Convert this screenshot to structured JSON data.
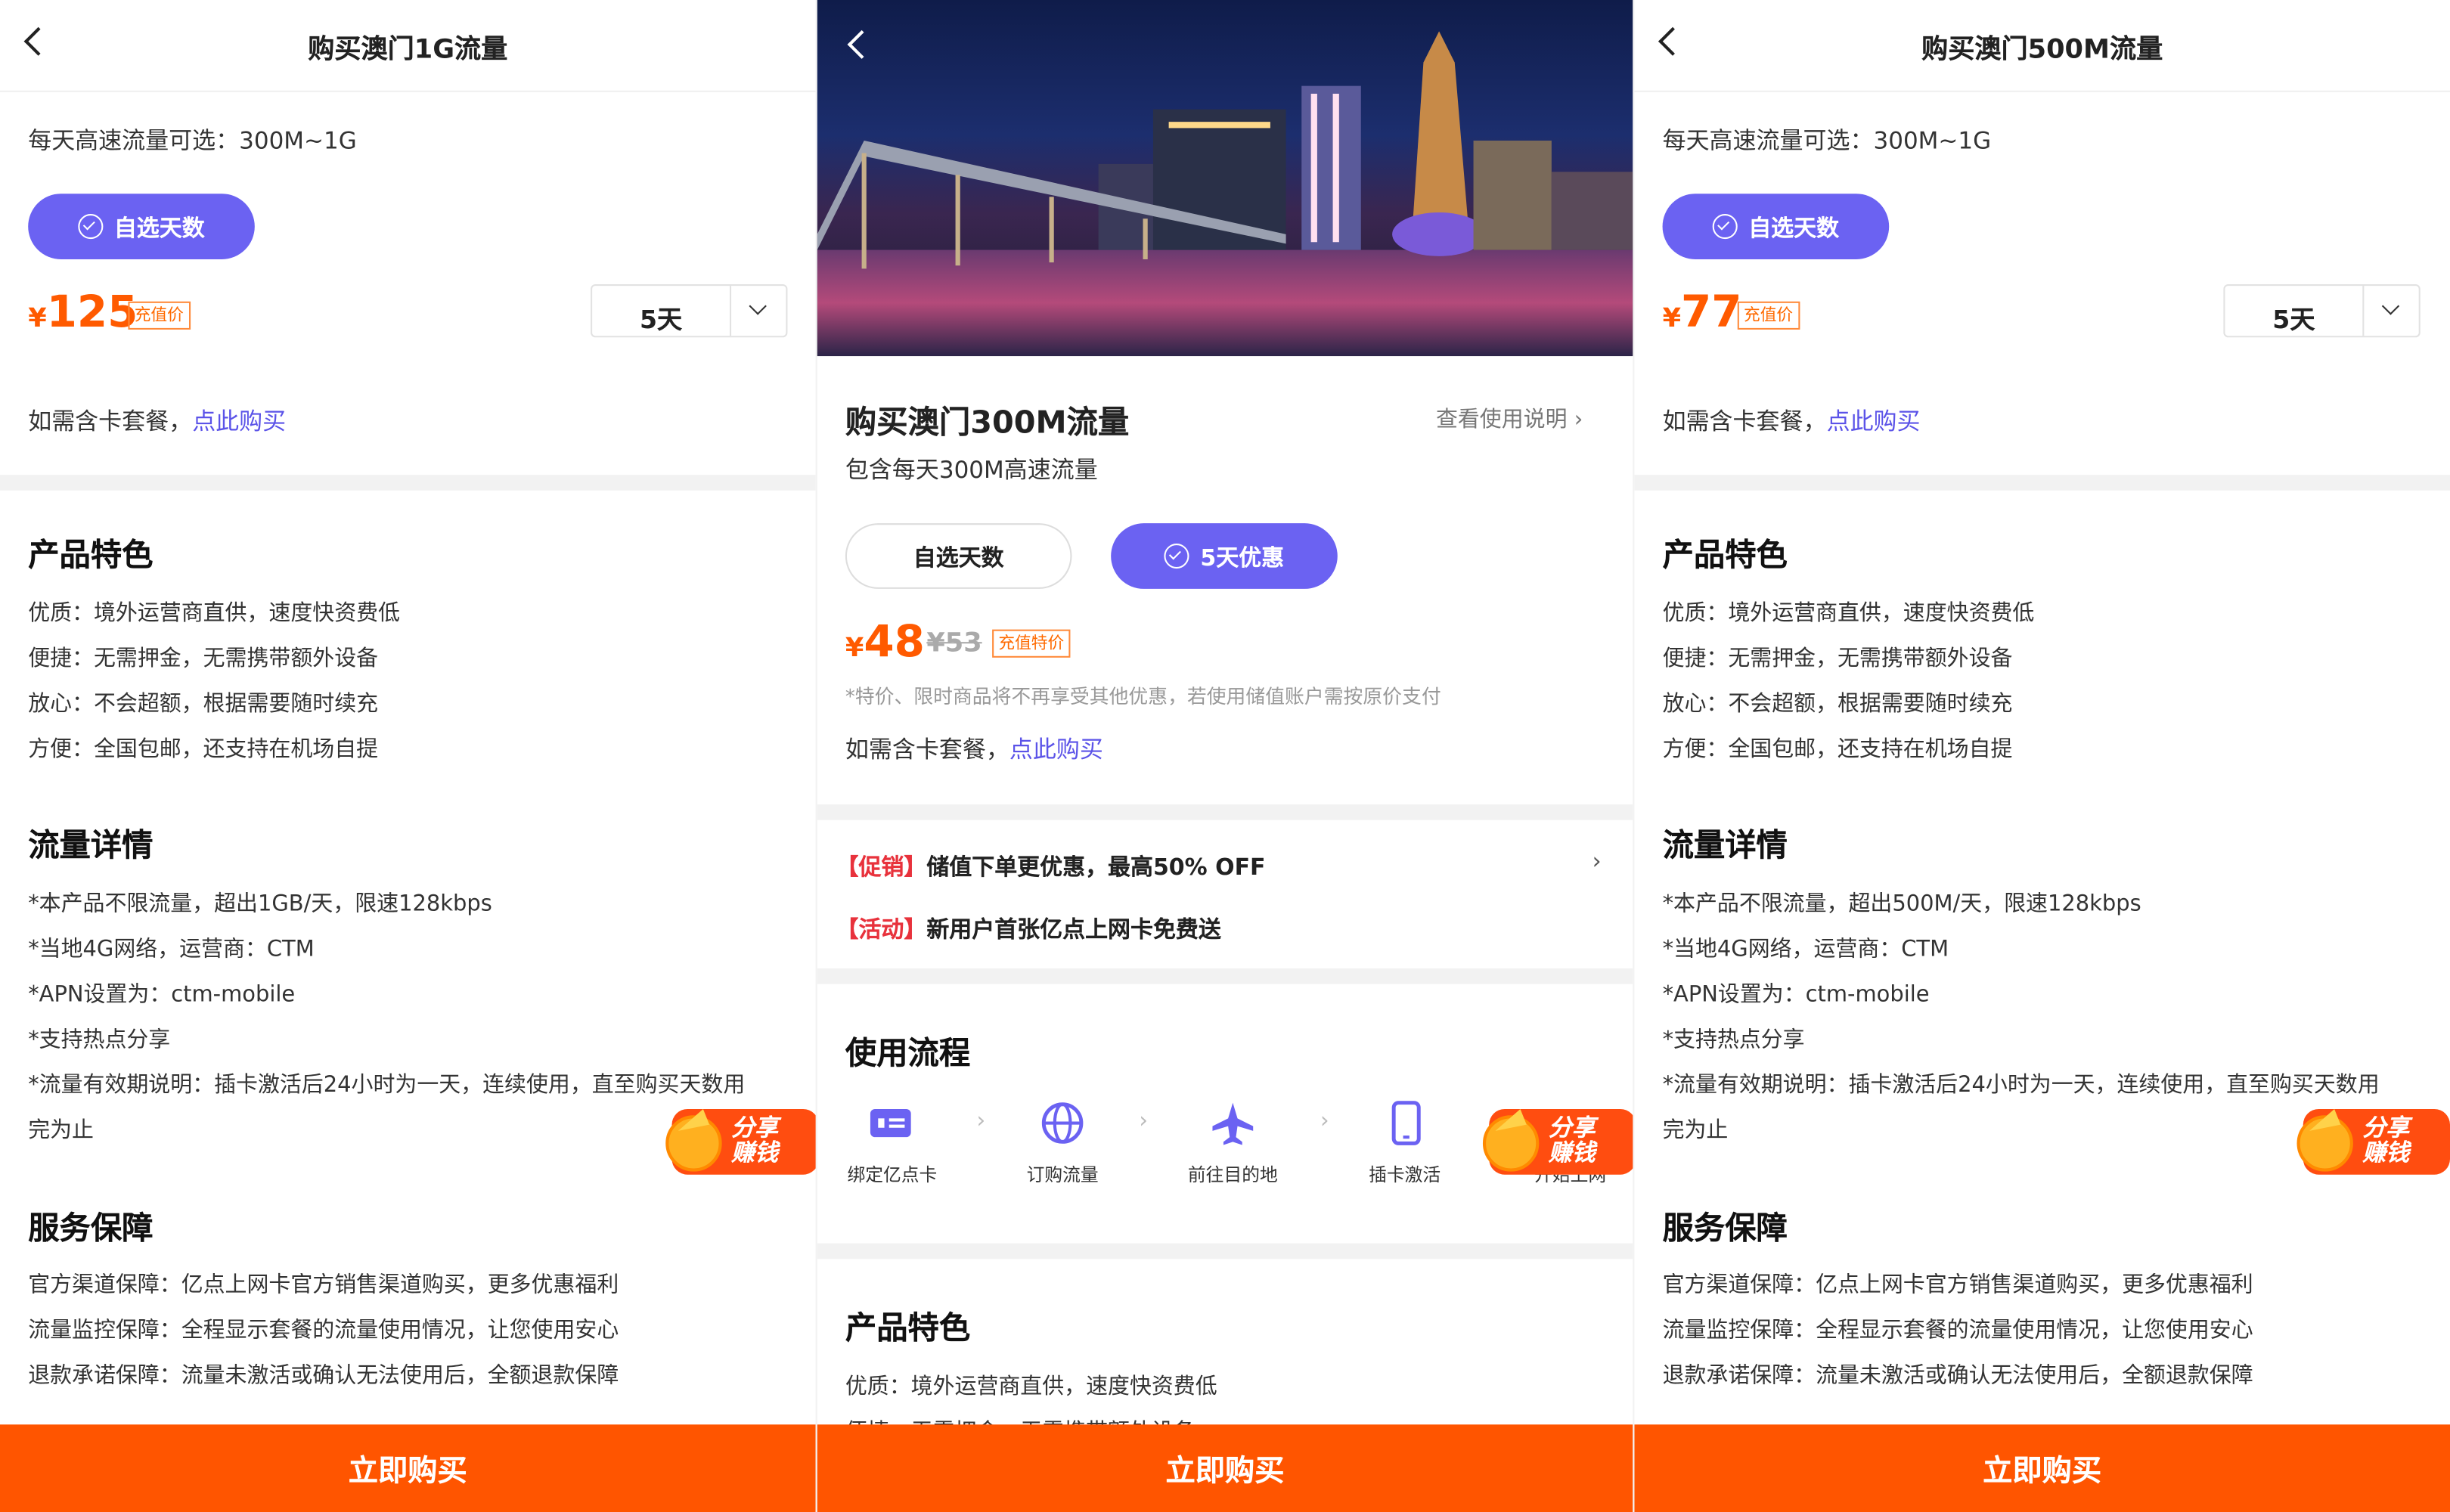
{
  "panel1": {
    "title": "购买澳门1G流量",
    "daily_option": "每天高速流量可选：300M~1G",
    "pill_label": "自选天数",
    "price_symbol": "¥",
    "price": "125",
    "price_tag": "充值价",
    "days_value": "5天",
    "card_prefix": "如需含卡套餐，",
    "card_link": "点此购买",
    "features_title": "产品特色",
    "features": [
      "优质：境外运营商直供，速度快资费低",
      "便捷：无需押金，无需携带额外设备",
      "放心：不会超额，根据需要随时续充",
      "方便：全国包邮，还支持在机场自提"
    ],
    "details_title": "流量详情",
    "details": [
      "*本产品不限流量，超出1GB/天，限速128kbps",
      "*当地4G网络，运营商：CTM",
      "*APN设置为：ctm-mobile",
      "*支持热点分享",
      "*流量有效期说明：插卡激活后24小时为一天，连续使用，直至购买天数用",
      "完为止"
    ],
    "service_title": "服务保障",
    "service": [
      "官方渠道保障：亿点上网卡官方销售渠道购买，更多优惠福利",
      "流量监控保障：全程显示套餐的流量使用情况，让您使用安心",
      "退款承诺保障：流量未激活或确认无法使用后，全额退款保障"
    ],
    "badge_line1": "分享",
    "badge_line2": "赚钱",
    "buy_label": "立即购买"
  },
  "panel2": {
    "title": "购买澳门300M流量",
    "instructions_link": "查看使用说明",
    "subtitle": "包含每天300M高速流量",
    "pill_custom": "自选天数",
    "pill_selected": "5天优惠",
    "price_symbol": "¥",
    "price": "48",
    "old_price": "¥53",
    "price_tag": "充值特价",
    "note": "*特价、限时商品将不再享受其他优惠，若使用储值账户需按原价支付",
    "card_prefix": "如需含卡套餐，",
    "card_link": "点此购买",
    "promo1_key": "【促销】",
    "promo1_text": "储值下单更优惠，最高50% OFF",
    "promo2_key": "【活动】",
    "promo2_text": "新用户首张亿点上网卡免费送",
    "flow_title": "使用流程",
    "steps": [
      "绑定亿点卡",
      "订购流量",
      "前往目的地",
      "插卡激活",
      "开始上网"
    ],
    "features_title": "产品特色",
    "features": [
      "优质：境外运营商直供，速度快资费低",
      "便捷：无需押金，无需携带额外设备"
    ],
    "badge_line1": "分享",
    "badge_line2": "赚钱",
    "buy_label": "立即购买",
    "colors": {
      "accent": "#6b62f2",
      "orange": "#ff5500",
      "promo_red": "#e8323c"
    }
  },
  "panel3": {
    "title": "购买澳门500M流量",
    "daily_option": "每天高速流量可选：300M~1G",
    "pill_label": "自选天数",
    "price_symbol": "¥",
    "price": "77",
    "price_tag": "充值价",
    "days_value": "5天",
    "card_prefix": "如需含卡套餐，",
    "card_link": "点此购买",
    "features_title": "产品特色",
    "features": [
      "优质：境外运营商直供，速度快资费低",
      "便捷：无需押金，无需携带额外设备",
      "放心：不会超额，根据需要随时续充",
      "方便：全国包邮，还支持在机场自提"
    ],
    "details_title": "流量详情",
    "details": [
      "*本产品不限流量，超出500M/天，限速128kbps",
      "*当地4G网络，运营商：CTM",
      "*APN设置为：ctm-mobile",
      "*支持热点分享",
      "*流量有效期说明：插卡激活后24小时为一天，连续使用，直至购买天数用",
      "完为止"
    ],
    "service_title": "服务保障",
    "service": [
      "官方渠道保障：亿点上网卡官方销售渠道购买，更多优惠福利",
      "流量监控保障：全程显示套餐的流量使用情况，让您使用安心",
      "退款承诺保障：流量未激活或确认无法使用后，全额退款保障"
    ],
    "badge_line1": "分享",
    "badge_line2": "赚钱",
    "buy_label": "立即购买"
  }
}
